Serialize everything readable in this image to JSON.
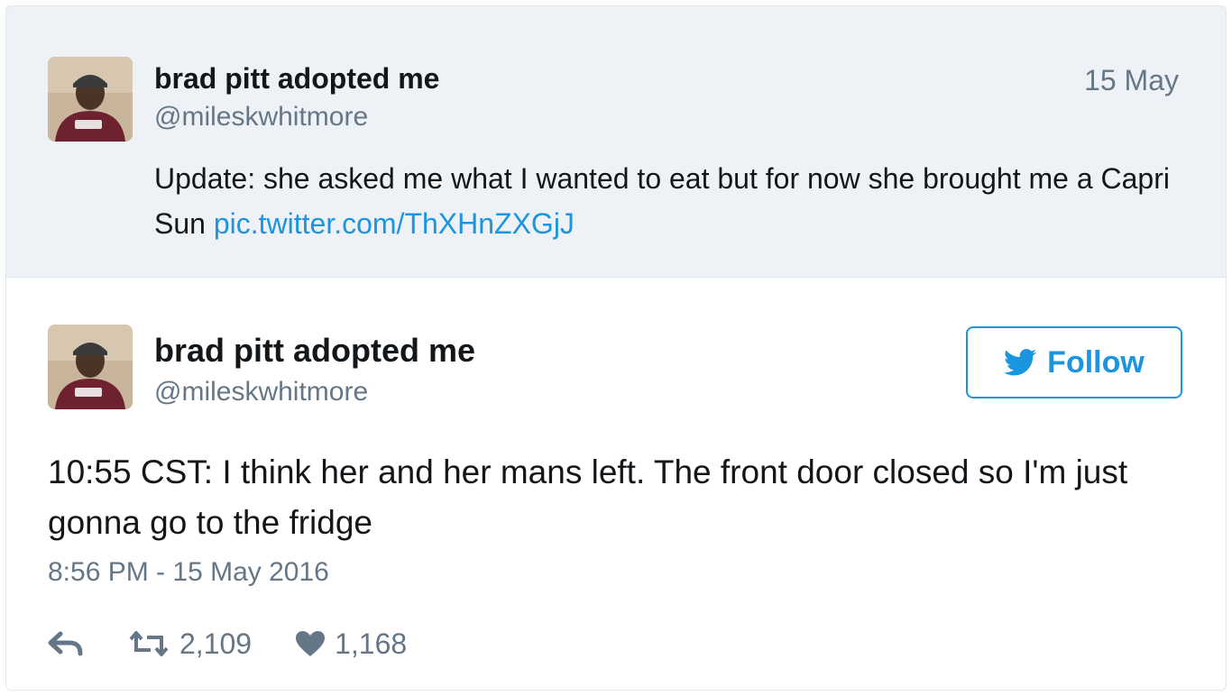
{
  "parent_tweet": {
    "display_name": "brad pitt adopted me",
    "handle": "@mileskwhitmore",
    "date": "15 May",
    "text": "Update: she asked me what I wanted to eat but for now she brought me a Capri Sun",
    "link": "pic.twitter.com/ThXHnZXGjJ"
  },
  "main_tweet": {
    "display_name": "brad pitt adopted me",
    "handle": "@mileskwhitmore",
    "follow_label": "Follow",
    "text": "10:55 CST: I think her and her mans left. The front door closed so I'm just gonna go to the fridge",
    "timestamp": "8:56 PM - 15 May 2016",
    "retweets": "2,109",
    "likes": "1,168"
  },
  "icons": {
    "reply": "reply-icon",
    "retweet": "retweet-icon",
    "like": "heart-icon",
    "follow": "bird-icon"
  },
  "colors": {
    "accent": "#1b95e0",
    "secondary_text": "#657786",
    "primary_text": "#14171a",
    "parent_background": "#eef2f7"
  }
}
